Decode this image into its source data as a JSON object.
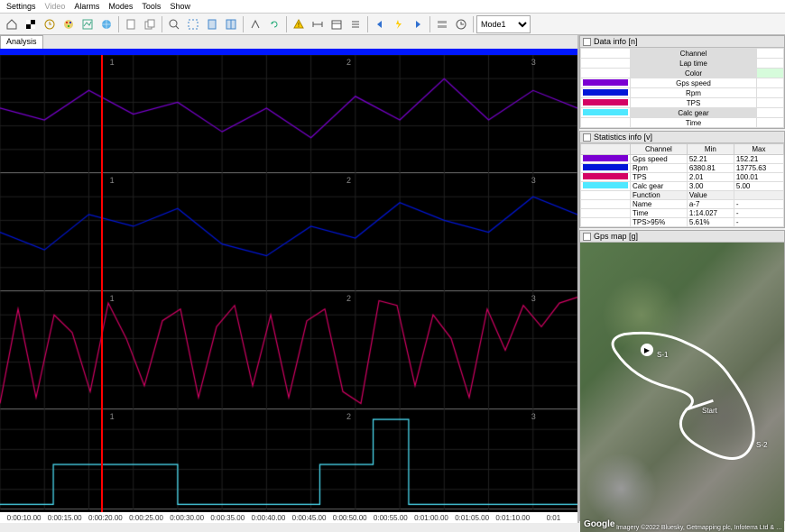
{
  "menu": {
    "items": [
      "Settings",
      "Video",
      "Alarms",
      "Modes",
      "Tools",
      "Show"
    ],
    "disabled": [
      1
    ]
  },
  "toolbar": {
    "mode_select": "Mode1"
  },
  "tab": {
    "label": "Analysis"
  },
  "cursor_x_frac": 0.175,
  "plot_markers": [
    "1",
    "2",
    "3"
  ],
  "xaxis": [
    "0:00:10.00",
    "0:00:15.00",
    "0:00:20.00",
    "0:00:25.00",
    "0:00:30.00",
    "0:00:35.00",
    "0:00:40.00",
    "0:00:45.00",
    "0:00:50.00",
    "0:00:55.00",
    "0:01:00.00",
    "0:01:05.00",
    "0:01:10.00",
    "0:01"
  ],
  "data_info": {
    "title": "Data info [n]",
    "headers": [
      "Channel",
      "Lap time",
      "Color"
    ],
    "rows": [
      {
        "color": "#7b00d2",
        "label": "Gps speed"
      },
      {
        "color": "#0016d8",
        "label": "Rpm"
      },
      {
        "color": "#d40264",
        "label": "TPS"
      },
      {
        "color": "#4fe8ff",
        "label": "Calc gear",
        "shaded": true
      },
      {
        "color": "",
        "label": "Time"
      }
    ]
  },
  "stats": {
    "title": "Statistics info [v]",
    "headers": [
      "",
      "Channel",
      "Min",
      "Max"
    ],
    "rows": [
      {
        "color": "#7b00d2",
        "channel": "Gps speed",
        "min": "52.21",
        "max": "152.21"
      },
      {
        "color": "#0016d8",
        "channel": "Rpm",
        "min": "6380.81",
        "max": "13775.63"
      },
      {
        "color": "#d40264",
        "channel": "TPS",
        "min": "2.01",
        "max": "100.01"
      },
      {
        "color": "#4fe8ff",
        "channel": "Calc gear",
        "min": "3.00",
        "max": "5.00"
      }
    ],
    "funcrows": [
      {
        "k": "Function",
        "v": "Value",
        "hdr": true
      },
      {
        "k": "Name",
        "v": "a-7"
      },
      {
        "k": "Time",
        "v": "1:14.027"
      },
      {
        "k": "TPS>95%",
        "v": "5.61%"
      }
    ]
  },
  "gpsmap": {
    "title": "Gps map [g]",
    "label_start": "Start",
    "label_s1": "S-1",
    "label_s2": "S-2",
    "attribution": "Imagery ©2022 Bluesky, Getmapping plc, Infoterra Ltd & …",
    "logo": "Google"
  },
  "chart_data": [
    {
      "type": "line",
      "name": "Gps speed",
      "color": "#7b00d2",
      "x_seconds": [
        10,
        15,
        20,
        25,
        30,
        35,
        40,
        45,
        50,
        55,
        60,
        65,
        70,
        75
      ],
      "values_norm": [
        0.55,
        0.45,
        0.7,
        0.5,
        0.6,
        0.35,
        0.55,
        0.3,
        0.65,
        0.45,
        0.8,
        0.45,
        0.7,
        0.55
      ],
      "ylim_actual": [
        52.21,
        152.21
      ]
    },
    {
      "type": "line",
      "name": "Rpm",
      "color": "#0016d8",
      "x_seconds": [
        10,
        15,
        20,
        25,
        30,
        35,
        40,
        45,
        50,
        55,
        60,
        65,
        70,
        75
      ],
      "values_norm": [
        0.5,
        0.35,
        0.65,
        0.55,
        0.7,
        0.4,
        0.3,
        0.55,
        0.45,
        0.75,
        0.6,
        0.5,
        0.8,
        0.65
      ],
      "ylim_actual": [
        6380.81,
        13775.63
      ]
    },
    {
      "type": "line",
      "name": "TPS",
      "color": "#d40264",
      "x_seconds": [
        10,
        12,
        14,
        16,
        18,
        20,
        22,
        24,
        26,
        28,
        30,
        32,
        34,
        36,
        38,
        40,
        42,
        44,
        46,
        48,
        50,
        52,
        54,
        56,
        58,
        60,
        62,
        64,
        66,
        68,
        70,
        72,
        74
      ],
      "values_norm": [
        0.05,
        0.85,
        0.1,
        0.8,
        0.65,
        0.15,
        0.9,
        0.6,
        0.2,
        0.75,
        0.85,
        0.1,
        0.7,
        0.88,
        0.2,
        0.8,
        0.1,
        0.75,
        0.85,
        0.15,
        0.05,
        0.92,
        0.88,
        0.2,
        0.8,
        0.6,
        0.1,
        0.85,
        0.5,
        0.88,
        0.7,
        0.9,
        0.95
      ],
      "ylim_actual": [
        2.01,
        100.01
      ]
    },
    {
      "type": "line",
      "name": "Calc gear",
      "color": "#4fe8ff",
      "step": true,
      "x_seconds": [
        10,
        14,
        16,
        28,
        30,
        44,
        46,
        50,
        52,
        54,
        56,
        58,
        75
      ],
      "values_norm": [
        0.05,
        0.05,
        0.45,
        0.45,
        0.05,
        0.05,
        0.45,
        0.45,
        0.9,
        0.9,
        0.05,
        0.05,
        0.05
      ],
      "ylim_actual": [
        3.0,
        5.0
      ]
    }
  ]
}
